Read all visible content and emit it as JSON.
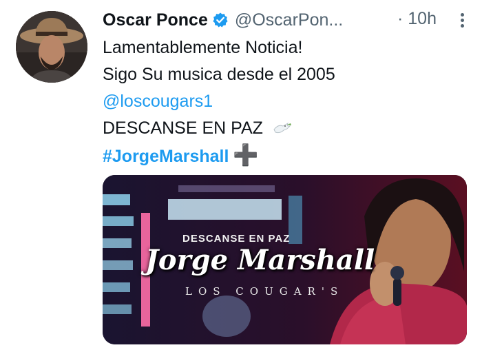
{
  "tweet": {
    "author": {
      "name": "Oscar Ponce",
      "handle": "@OscarPon...",
      "verified": true
    },
    "time": "· 10h",
    "lines": {
      "line1": "Lamentablemente Noticia!",
      "line2": "Sigo Su musica desde el 2005",
      "mention": "@loscougars1",
      "line4": "DESCANSE EN PAZ",
      "hashtag": "#JorgeMarshall",
      "plus": "➕"
    },
    "media": {
      "subtitle": "DESCANSE EN PAZ",
      "title": "Jorge Marshall",
      "band": "LOS COUGAR'S"
    }
  },
  "colors": {
    "link": "#1d9bf0",
    "verified": "#1d9bf0",
    "muted": "#536471",
    "text": "#0f1419"
  },
  "icons": {
    "verified": "verified-badge-icon",
    "more": "more-vertical-icon",
    "dove": "dove-emoji-icon"
  }
}
